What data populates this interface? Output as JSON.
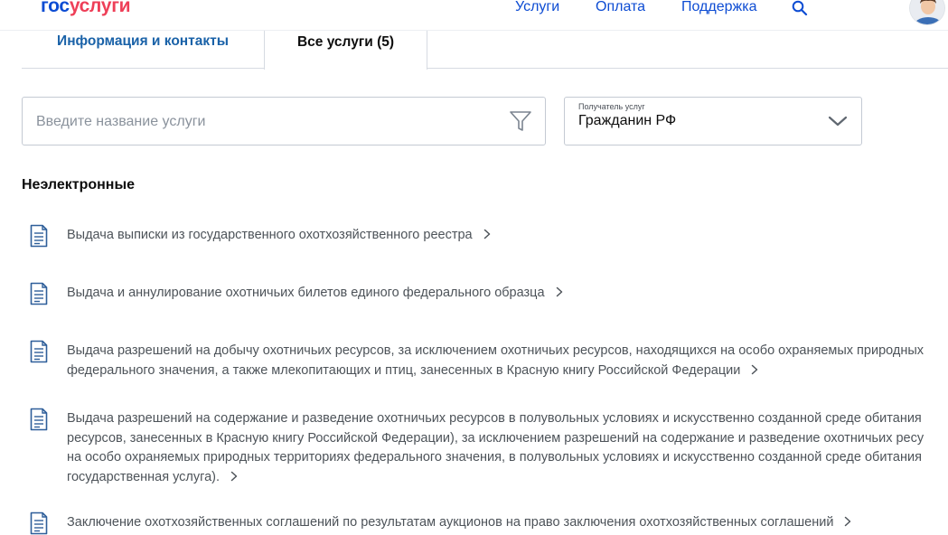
{
  "header": {
    "logo_part1": "гос",
    "logo_part2": "услуги",
    "nav": [
      "Услуги",
      "Оплата",
      "Поддержка"
    ],
    "icons": [
      "search-icon",
      "avatar"
    ]
  },
  "tabs": [
    {
      "label": "Информация и контакты",
      "active": false
    },
    {
      "label": "Все услуги (5)",
      "active": true
    }
  ],
  "search": {
    "placeholder": "Введите название услуги",
    "value": ""
  },
  "recipient": {
    "caption": "Получатель услуг",
    "value": "Гражданин РФ"
  },
  "section": {
    "title": "Неэлектронные",
    "services": [
      {
        "lines": [
          "Выдача выписки из государственного охотхозяйственного реестра"
        ]
      },
      {
        "lines": [
          "Выдача и аннулирование охотничьих билетов единого федерального образца"
        ]
      },
      {
        "lines": [
          "Выдача разрешений на добычу охотничьих ресурсов, за исключением охотничьих ресурсов, находящихся на особо охраняемых природных",
          "федерального значения, а также млекопитающих и птиц, занесенных в Красную книгу Российской Федерации"
        ]
      },
      {
        "lines": [
          "Выдача разрешений на содержание и разведение охотничьих ресурсов в полувольных условиях и искусственно созданной среде обитания",
          "ресурсов, занесенных в Красную книгу Российской Федерации), за исключением разрешений на содержание и разведение охотничьих ресу",
          "на особо охраняемых природных территориях федерального значения, в полувольных условиях и искусственно созданной среде обитания",
          "государственная услуга)."
        ]
      },
      {
        "lines": [
          "Заключение охотхозяйственных соглашений по результатам аукционов на право заключения охотхозяйственных соглашений"
        ]
      }
    ]
  },
  "colors": {
    "primary_blue": "#0d4cd3",
    "logo_red": "#ee3f58",
    "tab_link": "#1a62a8",
    "icon_blue": "#2f5f9a",
    "text_gray": "#4d5359"
  }
}
